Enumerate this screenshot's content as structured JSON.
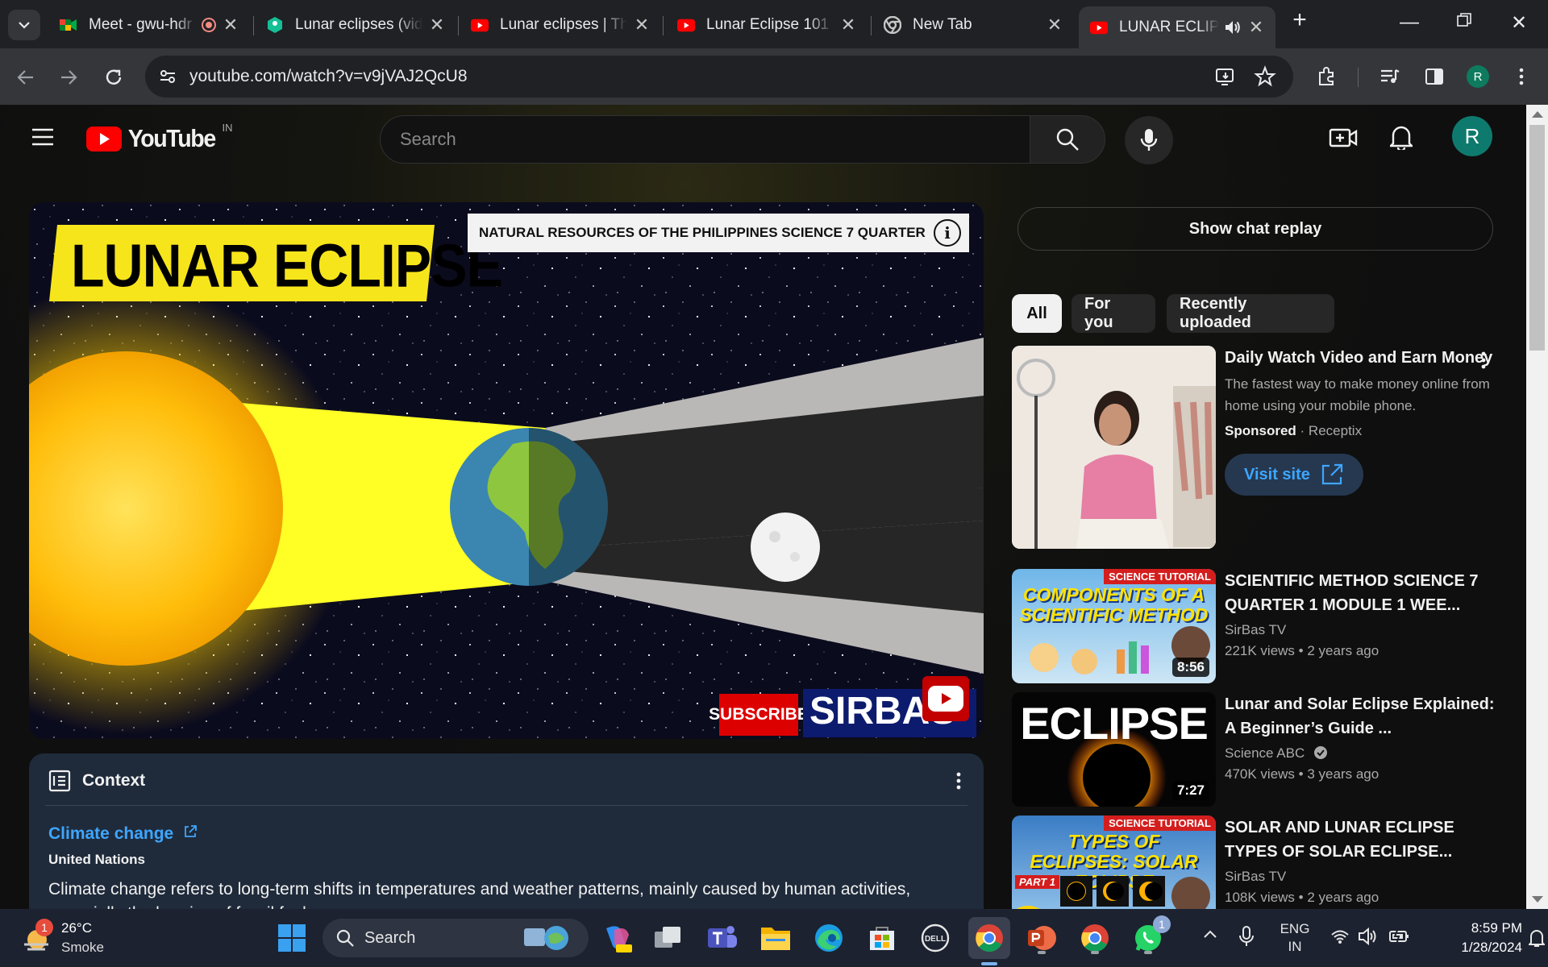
{
  "browser": {
    "tabs": [
      {
        "title": "Meet - gwu-hdr",
        "icon": "google-meet-icon"
      },
      {
        "title": "Lunar eclipses (video",
        "icon": "khan-academy-icon"
      },
      {
        "title": "Lunar eclipses | The",
        "icon": "youtube-icon"
      },
      {
        "title": "Lunar Eclipse 101 |",
        "icon": "youtube-icon"
      },
      {
        "title": "New Tab",
        "icon": "chrome-icon"
      },
      {
        "title": "LUNAR ECLIPSE",
        "icon": "youtube-icon"
      }
    ],
    "url": "youtube.com/watch?v=v9jVAJ2QcU8",
    "profile_initial": "R"
  },
  "youtube": {
    "logo_text": "YouTube",
    "country": "IN",
    "search_placeholder": "Search",
    "avatar_initial": "R",
    "video": {
      "title_overlay": "LUNAR ECLIPSE",
      "banner_text": "NATURAL RESOURCES OF THE PHILIPPINES SCIENCE 7 QUARTER ...",
      "subscribe_text": "SUBSCRIBE",
      "channel_overlay": "SIRBAS TV"
    },
    "context": {
      "header": "Context",
      "link_text": "Climate change",
      "source": "United Nations",
      "body": "Climate change refers to long-term shifts in temperatures and weather patterns, mainly caused by human activities, especially the burning of fossil fuels."
    },
    "sidebar": {
      "chat_replay": "Show chat replay",
      "chips": [
        "All",
        "For you",
        "Recently uploaded"
      ],
      "ad": {
        "title": "Daily Watch Video and Earn Money",
        "description": "The fastest way to make money online from home using your mobile phone.",
        "sponsored": "Sponsored",
        "advertiser": "Receptix",
        "cta": "Visit site"
      },
      "recommendations": [
        {
          "title": "SCIENTIFIC METHOD SCIENCE 7 QUARTER 1 MODULE 1 WEE...",
          "channel": "SirBas TV",
          "views": "221K views",
          "age": "2 years ago",
          "duration": "8:56",
          "thumb_text": "COMPONENTS OF A SCIENTIFIC METHOD",
          "thumb_tag": "SCIENCE TUTORIAL",
          "verified": false
        },
        {
          "title": "Lunar and Solar Eclipse Explained: A Beginner’s Guide ...",
          "channel": "Science ABC",
          "views": "470K views",
          "age": "3 years ago",
          "duration": "7:27",
          "thumb_text": "ECLIPSE",
          "thumb_tag": "",
          "verified": true
        },
        {
          "title": "SOLAR AND LUNAR ECLIPSE TYPES OF SOLAR ECLIPSE...",
          "channel": "SirBas TV",
          "views": "108K views",
          "age": "2 years ago",
          "duration": "",
          "thumb_text": "TYPES OF ECLIPSES: SOLAR ECLIPSE",
          "thumb_tag": "SCIENCE TUTORIAL",
          "thumb_part": "PART 1",
          "verified": false
        }
      ]
    }
  },
  "taskbar": {
    "weather_temp": "26°C",
    "weather_desc": "Smoke",
    "weather_badge": "1",
    "search_label": "Search",
    "whatsapp_badge": "1",
    "lang_line1": "ENG",
    "lang_line2": "IN",
    "time": "8:59 PM",
    "date": "1/28/2024"
  }
}
